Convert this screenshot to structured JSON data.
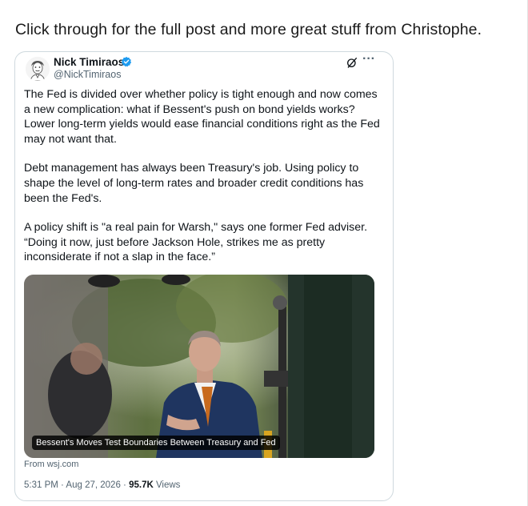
{
  "intro_text": "Click through for the full post and more great stuff from Christophe.",
  "tweet": {
    "author_name": "Nick Timiraos",
    "author_handle": "@NickTimiraos",
    "paragraphs": [
      "The Fed is divided over whether policy is tight enough and now comes a new complication: what if Bessent's push on bond yields works? Lower long-term yields would ease financial conditions right as the Fed may not want that.",
      "Debt management has always been Treasury's job. Using policy to shape the level of long-term rates and broader credit conditions has been the Fed's.",
      "A policy shift is \"a real pain for Warsh,\" says one former Fed adviser. “Doing it now, just before Jackson Hole, strikes me as pretty inconsiderate if not a slap in the face.”"
    ],
    "media_caption": "Bessent's Moves Test Boundaries Between Treasury and Fed",
    "source": "From wsj.com",
    "time": "5:31 PM",
    "date": "Aug 27, 2026",
    "views_count": "95.7K",
    "views_label": "Views"
  },
  "colors": {
    "text_primary": "#0f1419",
    "text_secondary": "#536471",
    "verified_blue": "#1d9bf0",
    "card_border": "#cfd9de"
  },
  "icons": [
    "verified-badge-icon",
    "grok-icon",
    "more-options-icon"
  ]
}
